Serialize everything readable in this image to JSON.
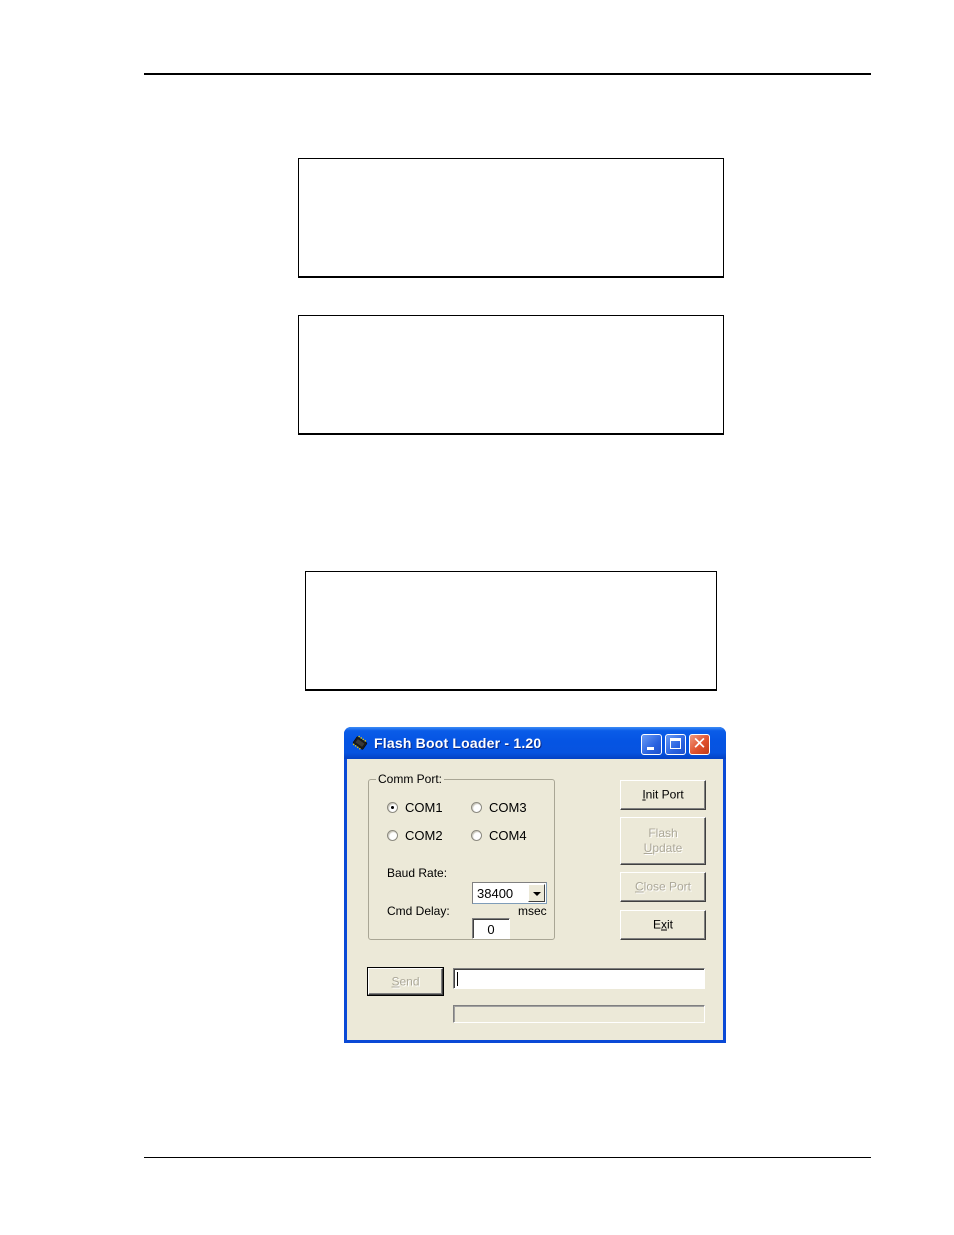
{
  "page": {
    "frames": [
      {
        "id": "frame-1",
        "content": ""
      },
      {
        "id": "frame-2",
        "content": ""
      },
      {
        "id": "frame-3",
        "content": ""
      }
    ]
  },
  "window": {
    "title": "Flash Boot Loader - 1.20",
    "icon": "chip-icon",
    "controls": {
      "minimize": "minimize-icon",
      "maximize": "maximize-icon",
      "close": "close-icon",
      "close_glyph": "✕"
    },
    "comm_port": {
      "legend": "Comm Port:",
      "options": [
        {
          "label": "COM1",
          "checked": true
        },
        {
          "label": "COM2",
          "checked": false
        },
        {
          "label": "COM3",
          "checked": false
        },
        {
          "label": "COM4",
          "checked": false
        }
      ],
      "baud_rate_label": "Baud Rate:",
      "baud_rate_value": "38400",
      "cmd_delay_label": "Cmd Delay:",
      "cmd_delay_value": "0",
      "cmd_delay_unit": "msec"
    },
    "buttons": {
      "init_port": {
        "mnemonic": "I",
        "rest": "nit Port",
        "enabled": true
      },
      "flash_update": {
        "line1": "Flash",
        "mnemonic": "U",
        "rest": "pdate",
        "enabled": false
      },
      "close_port": {
        "mnemonic": "C",
        "rest": "lose Port",
        "enabled": false
      },
      "exit": {
        "pre": "E",
        "mnemonic": "x",
        "rest": "it",
        "enabled": true
      },
      "send": {
        "mnemonic": "S",
        "rest": "end",
        "enabled": false
      }
    },
    "command_input": {
      "value": ""
    },
    "status_bar": {
      "text": ""
    }
  }
}
